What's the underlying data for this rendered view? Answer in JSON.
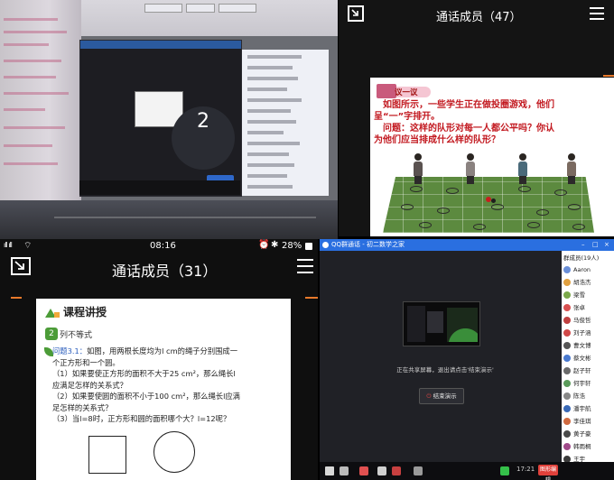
{
  "q1": {
    "count_display": "2"
  },
  "q2": {
    "title": "通话成员（47）",
    "slide": {
      "tag": "议一议",
      "line1": "如图所示，一些学生正在做投圈游戏，他们",
      "line2": "呈“一”字排开。",
      "line3": "问题：这样的队形对每一人都公平吗？你认",
      "line4": "为他们应当排成什么样的队形？"
    }
  },
  "q3": {
    "status_time": "08:16",
    "status_left": "ıll ıll",
    "status_battery": "28%",
    "title": "通话成员（31）",
    "slide": {
      "heading": "课程讲授",
      "section_num": "2",
      "section_label": "列不等式",
      "q_label": "问题3.1：",
      "line1": "如图，用两根长度均为l cm的绳子分别围成一",
      "line2": "个正方形和一个圆。",
      "line3": "（1）如果要使正方形的面积不大于25 cm²，那么绳长l",
      "line4": "应满足怎样的关系式？",
      "line5": "（2）如果要使圆的面积不小于100 cm²，那么绳长l应满",
      "line6": "足怎样的关系式？",
      "line7": "（3）当l=8时，正方形和圆的面积哪个大？l=12呢？"
    }
  },
  "q4": {
    "window_title": "QQ群通话 - 初二数学之家",
    "caption": "正在共享屏幕，退出请点击'结束演示'",
    "stop_label": "结束演示",
    "panel_header": "群成员(19人)",
    "members": [
      "Aaron",
      "胡浩杰",
      "梁雪",
      "张卓",
      "马俊哲",
      "刘子涵",
      "曹文博",
      "蔡文彬",
      "赵子轩",
      "何宇轩",
      "陈浩",
      "潘宇航",
      "李佳琪",
      "黄子豪",
      "韩雨桐",
      "王宇"
    ],
    "taskbar_time": "17:21",
    "taskbar_red": "图形编辑",
    "colors": {
      "titlebar": "#2a6fe0",
      "stop_red": "#e04545"
    }
  }
}
